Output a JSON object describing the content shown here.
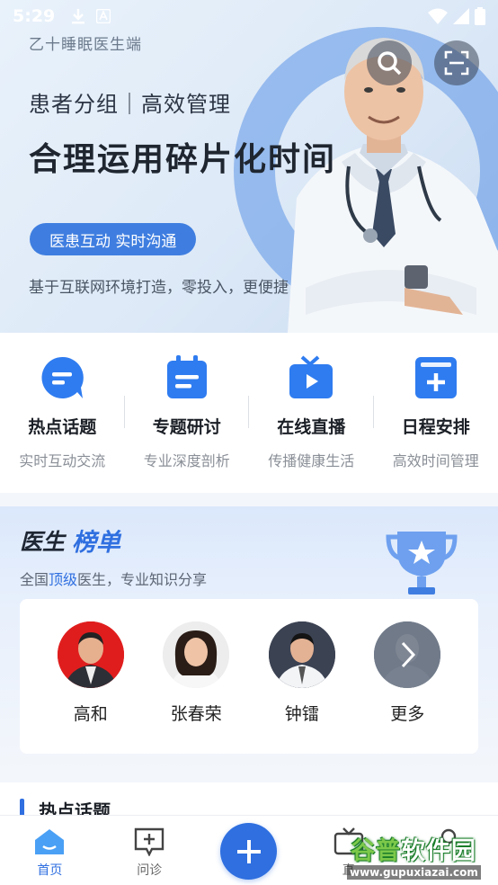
{
  "status_bar": {
    "time": "5:29"
  },
  "banner": {
    "brand": "乙十睡眠医生端",
    "subtitle": "患者分组｜高效管理",
    "headline": "合理运用碎片化时间",
    "pill": "医患互动 实时沟通",
    "desc": "基于互联网环境打造，零投入，更便捷"
  },
  "quick_menu": [
    {
      "title": "热点话题",
      "sub": "实时互动交流",
      "icon": "chat-bubble-icon"
    },
    {
      "title": "专题研讨",
      "sub": "专业深度剖析",
      "icon": "notepad-icon"
    },
    {
      "title": "在线直播",
      "sub": "传播健康生活",
      "icon": "tv-play-icon"
    },
    {
      "title": "日程安排",
      "sub": "高效时间管理",
      "icon": "calendar-add-icon"
    }
  ],
  "ranking": {
    "title_a": "医生",
    "title_b": "榜单",
    "sub_a": "全国",
    "sub_hl": "顶级",
    "sub_b": "医生，专业知识分享",
    "doctors": [
      {
        "name": "高和"
      },
      {
        "name": "张春荣"
      },
      {
        "name": "钟镭"
      },
      {
        "name": "更多"
      }
    ]
  },
  "hot_section": {
    "title": "热点话题"
  },
  "bottom_nav": {
    "tabs": [
      {
        "label": "首页",
        "icon": "home-icon"
      },
      {
        "label": "问诊",
        "icon": "consult-icon"
      },
      {
        "label": "",
        "icon": "plus-icon"
      },
      {
        "label": "直",
        "icon": "live-tv-icon"
      },
      {
        "label": "",
        "icon": "profile-icon"
      }
    ]
  },
  "watermark": {
    "a": "谷普",
    "b": "软件园",
    "url": "www.gupuxiazai.com"
  },
  "colors": {
    "accent": "#2f6fe0",
    "pill": "#3f7ee0"
  }
}
